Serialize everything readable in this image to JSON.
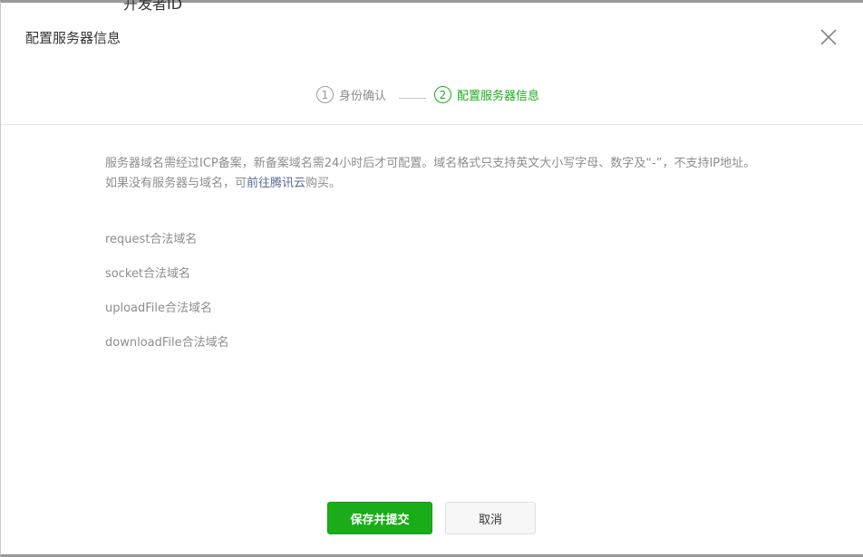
{
  "background_title": "开发者ID",
  "dialog": {
    "title": "配置服务器信息"
  },
  "steps": [
    {
      "number": "1",
      "label": "身份确认"
    },
    {
      "number": "2",
      "label": "配置服务器信息"
    }
  ],
  "description": {
    "text_before": "服务器域名需经过ICP备案，新备案域名需24小时后才可配置。域名格式只支持英文大小写字母、数字及“-”，不支持IP地址。如果没有服务器与域名，可",
    "link": "前往腾讯云",
    "text_after": "购买。"
  },
  "fields": [
    {
      "label": "request合法域名"
    },
    {
      "label": "socket合法域名"
    },
    {
      "label": "uploadFile合法域名"
    },
    {
      "label": "downloadFile合法域名"
    }
  ],
  "buttons": {
    "submit_label": "保存并提交",
    "cancel_label": "取消"
  },
  "colors": {
    "accent": "#1aad19",
    "link": "#576b95",
    "muted": "#8d8d8d"
  },
  "icons": {
    "close": "close-icon"
  }
}
